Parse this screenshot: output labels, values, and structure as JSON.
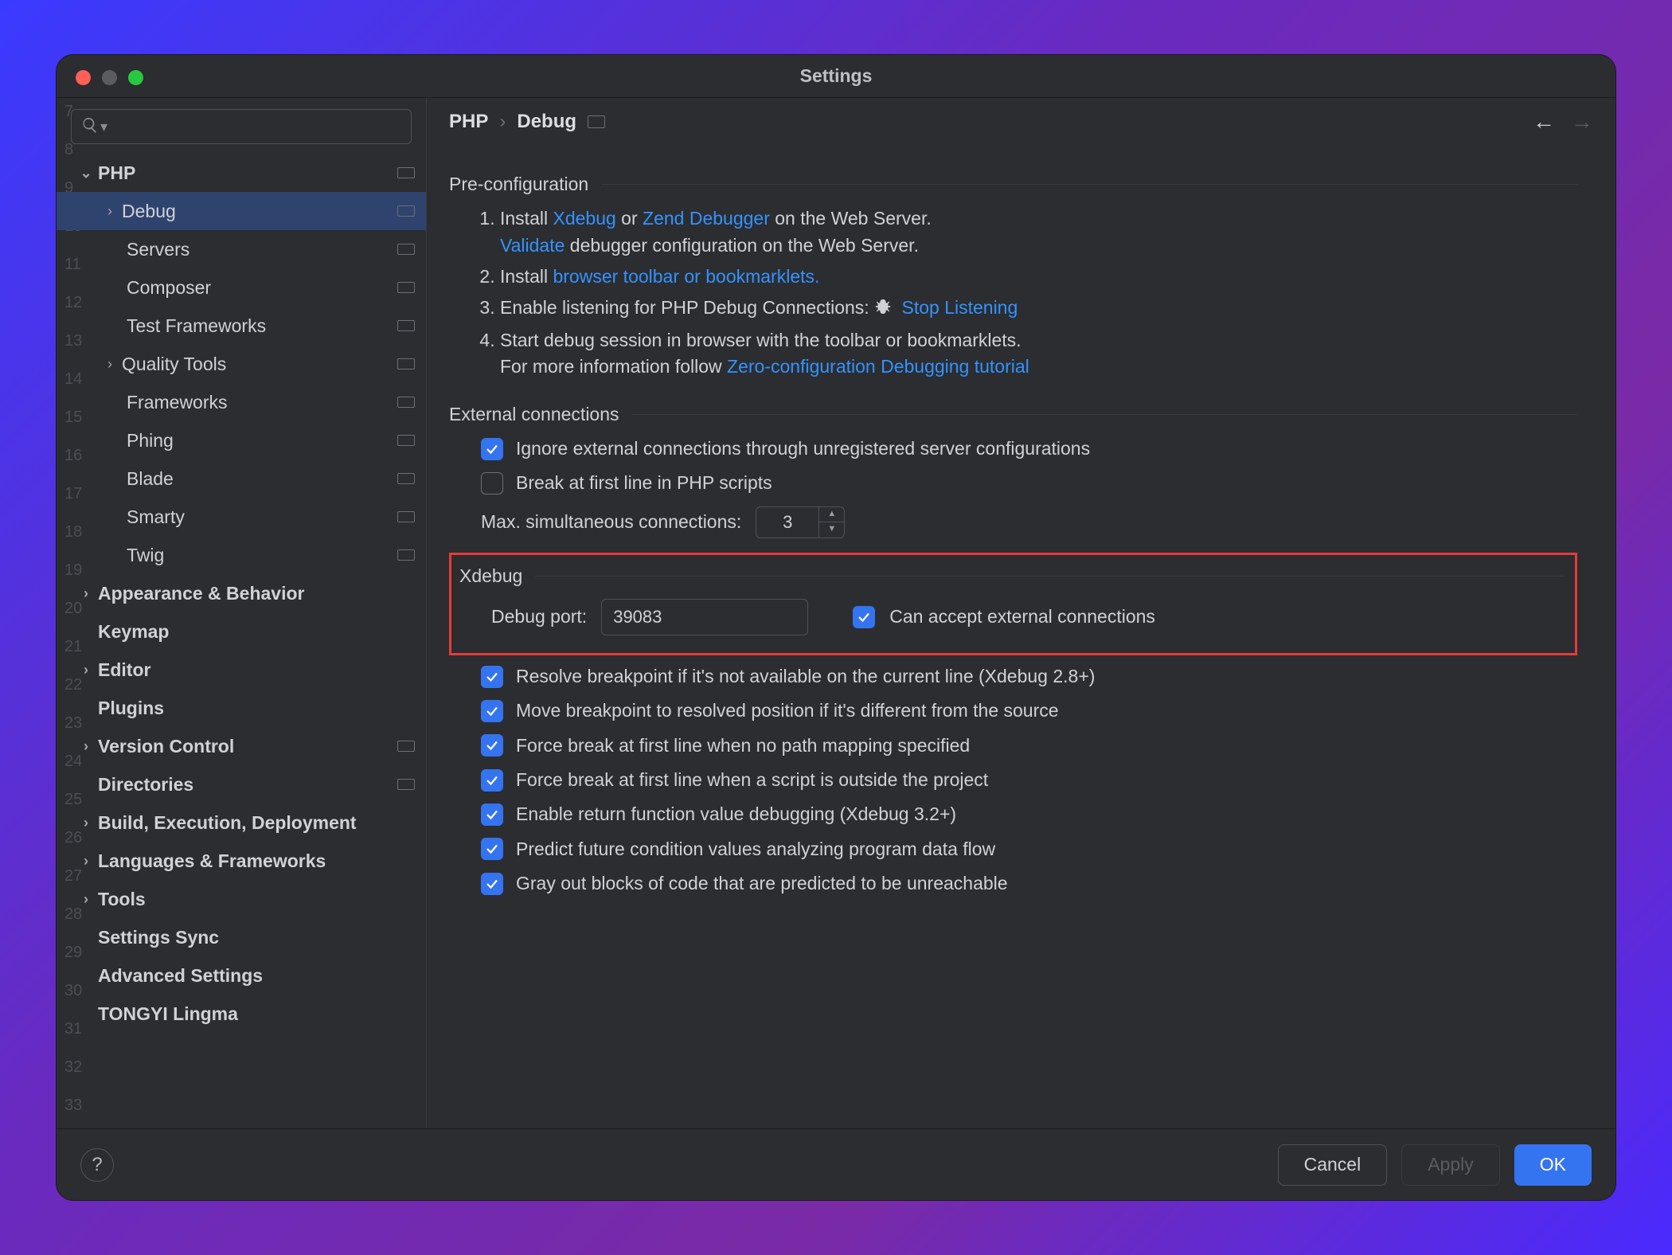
{
  "dialog": {
    "title": "Settings"
  },
  "breadcrumb": {
    "root": "PHP",
    "leaf": "Debug"
  },
  "sidebar": {
    "php": "PHP",
    "debug": "Debug",
    "servers": "Servers",
    "composer": "Composer",
    "test_frameworks": "Test Frameworks",
    "quality_tools": "Quality Tools",
    "frameworks": "Frameworks",
    "phing": "Phing",
    "blade": "Blade",
    "smarty": "Smarty",
    "twig": "Twig",
    "appearance": "Appearance & Behavior",
    "keymap": "Keymap",
    "editor": "Editor",
    "plugins": "Plugins",
    "version_control": "Version Control",
    "directories": "Directories",
    "build": "Build, Execution, Deployment",
    "languages": "Languages & Frameworks",
    "tools": "Tools",
    "settings_sync": "Settings Sync",
    "advanced": "Advanced Settings",
    "tongyi": "TONGYI Lingma"
  },
  "sections": {
    "preconfig": "Pre-configuration",
    "external": "External connections",
    "xdebug": "Xdebug"
  },
  "preconfig": {
    "l1a": "Install ",
    "l1b": " or ",
    "l1c": " on the Web Server.",
    "xdebug_link": "Xdebug",
    "zend_link": "Zend Debugger",
    "validate_link": "Validate",
    "l1d": " debugger configuration on the Web Server.",
    "l2a": "Install ",
    "l2b": "browser toolbar or bookmarklets.",
    "l3a": "Enable listening for PHP Debug Connections:  ",
    "stop_listening": "Stop Listening",
    "l4a": "Start debug session in browser with the toolbar or bookmarklets.",
    "l4b": "For more information follow ",
    "zero_conf": "Zero-configuration Debugging tutorial"
  },
  "external": {
    "ignore": "Ignore external connections through unregistered server configurations",
    "break_first": "Break at first line in PHP scripts",
    "max_label": "Max. simultaneous connections:",
    "max_value": "3"
  },
  "xdebug": {
    "port_label": "Debug port:",
    "port_value": "39083",
    "accept": "Can accept external connections",
    "resolve": "Resolve breakpoint if it's not available on the current line (Xdebug 2.8+)",
    "move": "Move breakpoint to resolved position if it's different from the source",
    "force_no_path": "Force break at first line when no path mapping specified",
    "force_outside": "Force break at first line when a script is outside the project",
    "return_val": "Enable return function value debugging (Xdebug 3.2+)",
    "predict": "Predict future condition values analyzing program data flow",
    "gray_out": "Gray out blocks of code that are predicted to be unreachable"
  },
  "footer": {
    "cancel": "Cancel",
    "apply": "Apply",
    "ok": "OK"
  }
}
